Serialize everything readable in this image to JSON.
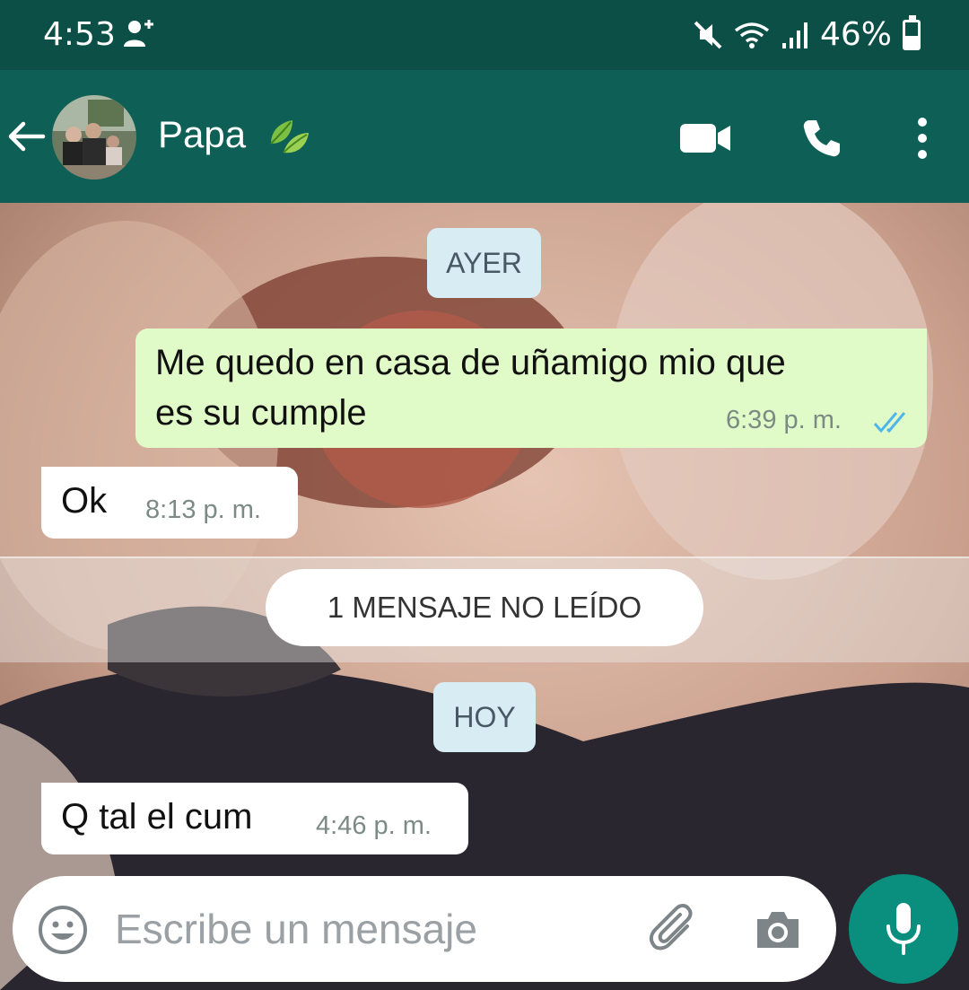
{
  "status_bar": {
    "time": "4:53",
    "battery": "46%",
    "battery_level": 0.46,
    "icons": [
      "user-add-icon",
      "mute-icon",
      "wifi-icon",
      "signal-icon",
      "battery-icon"
    ]
  },
  "header": {
    "contact_name": "Papa",
    "name_emoji": "leaf-icon",
    "actions": [
      "video-call-icon",
      "phone-call-icon",
      "more-options-icon"
    ]
  },
  "chat": {
    "date_yesterday": "AYER",
    "date_today": "HOY",
    "unread_label": "1 MENSAJE NO LEÍDO",
    "messages": [
      {
        "direction": "out",
        "line1": "Me quedo en casa de uñamigo mio que",
        "line2": "es su cumple",
        "time": "6:39 p. m.",
        "status": "read"
      },
      {
        "direction": "in",
        "text": "Ok",
        "time": "8:13 p. m."
      },
      {
        "direction": "in",
        "text": "Q tal el cum",
        "time": "4:46 p. m."
      }
    ]
  },
  "input": {
    "placeholder": "Escribe un mensaje"
  },
  "colors": {
    "status_bar": "#0b4f47",
    "app_bar": "#0e5f55",
    "outgoing_bubble": "#e1fbc8",
    "incoming_bubble": "#ffffff",
    "date_chip": "#d8ecf3",
    "mic_button": "#0a8f7e",
    "read_ticks": "#4fb6ec"
  }
}
